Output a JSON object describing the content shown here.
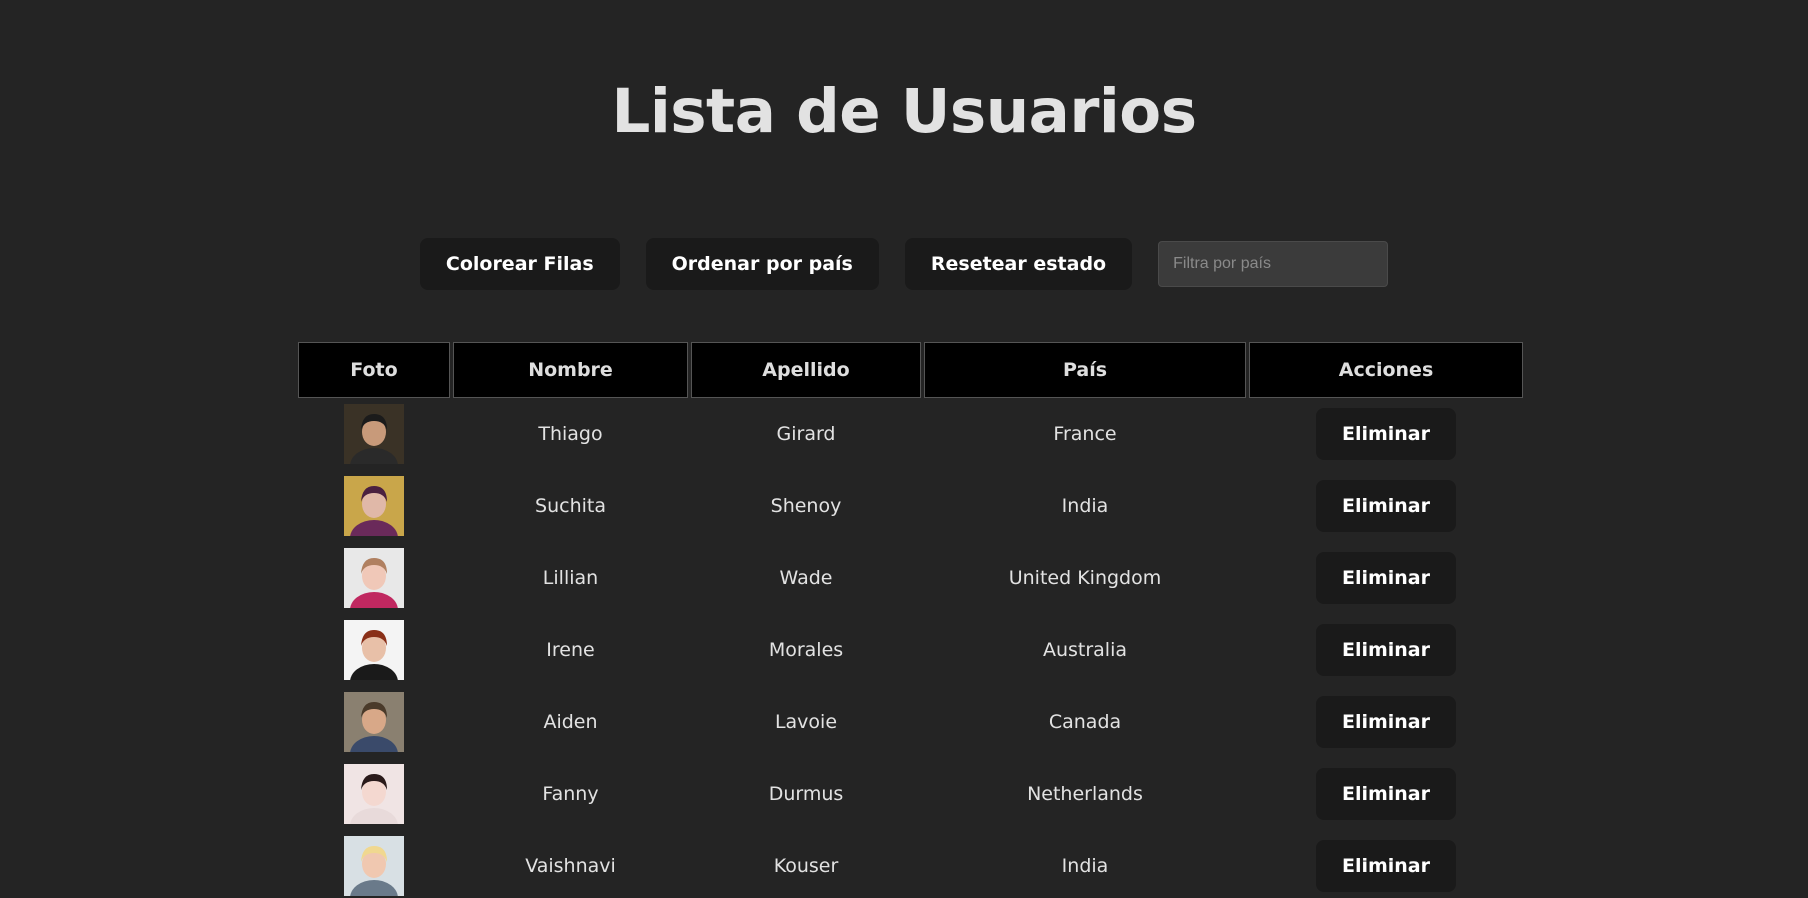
{
  "title": "Lista de Usuarios",
  "toolbar": {
    "color_rows_label": "Colorear Filas",
    "sort_country_label": "Ordenar por país",
    "reset_label": "Resetear estado",
    "filter_placeholder": "Filtra por país"
  },
  "table": {
    "headers": [
      "Foto",
      "Nombre",
      "Apellido",
      "País",
      "Acciones"
    ],
    "delete_label": "Eliminar",
    "rows": [
      {
        "nombre": "Thiago",
        "apellido": "Girard",
        "pais": "France"
      },
      {
        "nombre": "Suchita",
        "apellido": "Shenoy",
        "pais": "India"
      },
      {
        "nombre": "Lillian",
        "apellido": "Wade",
        "pais": "United Kingdom"
      },
      {
        "nombre": "Irene",
        "apellido": "Morales",
        "pais": "Australia"
      },
      {
        "nombre": "Aiden",
        "apellido": "Lavoie",
        "pais": "Canada"
      },
      {
        "nombre": "Fanny",
        "apellido": "Durmus",
        "pais": "Netherlands"
      },
      {
        "nombre": "Vaishnavi",
        "apellido": "Kouser",
        "pais": "India"
      }
    ]
  }
}
